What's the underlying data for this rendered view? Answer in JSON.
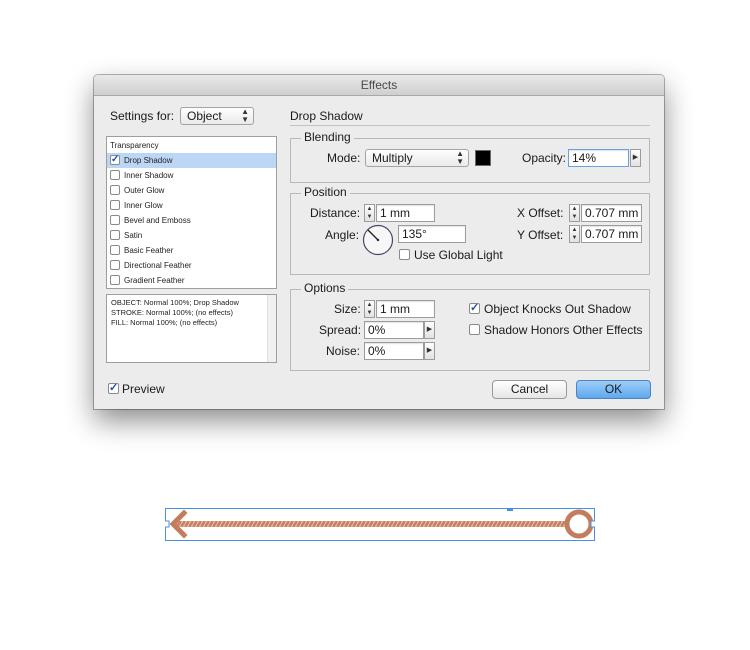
{
  "dialog": {
    "title": "Effects"
  },
  "settings_for": {
    "label": "Settings for:",
    "value": "Object"
  },
  "section_title": "Drop Shadow",
  "effects_list": {
    "header": "Transparency",
    "items": [
      {
        "label": "Drop Shadow",
        "checked": true,
        "selected": true
      },
      {
        "label": "Inner Shadow",
        "checked": false
      },
      {
        "label": "Outer Glow",
        "checked": false
      },
      {
        "label": "Inner Glow",
        "checked": false
      },
      {
        "label": "Bevel and Emboss",
        "checked": false
      },
      {
        "label": "Satin",
        "checked": false
      },
      {
        "label": "Basic Feather",
        "checked": false
      },
      {
        "label": "Directional Feather",
        "checked": false
      },
      {
        "label": "Gradient Feather",
        "checked": false
      }
    ]
  },
  "summary": {
    "line1": "OBJECT: Normal 100%; Drop Shadow",
    "line2": "STROKE: Normal 100%; (no effects)",
    "line3": "FILL: Normal 100%; (no effects)"
  },
  "blending": {
    "title": "Blending",
    "mode_label": "Mode:",
    "mode_value": "Multiply",
    "color_swatch": "#000000",
    "opacity_label": "Opacity:",
    "opacity_value": "14%"
  },
  "position": {
    "title": "Position",
    "distance_label": "Distance:",
    "distance_value": "1 mm",
    "angle_label": "Angle:",
    "angle_value": "135°",
    "global_light_label": "Use Global Light",
    "global_light_checked": false,
    "x_offset_label": "X Offset:",
    "x_offset_value": "0.707 mm",
    "y_offset_label": "Y Offset:",
    "y_offset_value": "0.707 mm"
  },
  "options": {
    "title": "Options",
    "size_label": "Size:",
    "size_value": "1 mm",
    "spread_label": "Spread:",
    "spread_value": "0%",
    "noise_label": "Noise:",
    "noise_value": "0%",
    "knocks_out_label": "Object Knocks Out Shadow",
    "knocks_out_checked": true,
    "honors_label": "Shadow Honors Other Effects",
    "honors_checked": false
  },
  "preview": {
    "label": "Preview",
    "checked": true
  },
  "buttons": {
    "cancel": "Cancel",
    "ok": "OK"
  },
  "colors": {
    "accent": "#5ea8ee",
    "arrow": "#c47c5f",
    "selection": "#4a90e2"
  },
  "icons": {
    "angle_dial": "angle-dial-icon",
    "arrow_left": "arrow-left-icon",
    "circle_end": "circle-end-icon"
  }
}
